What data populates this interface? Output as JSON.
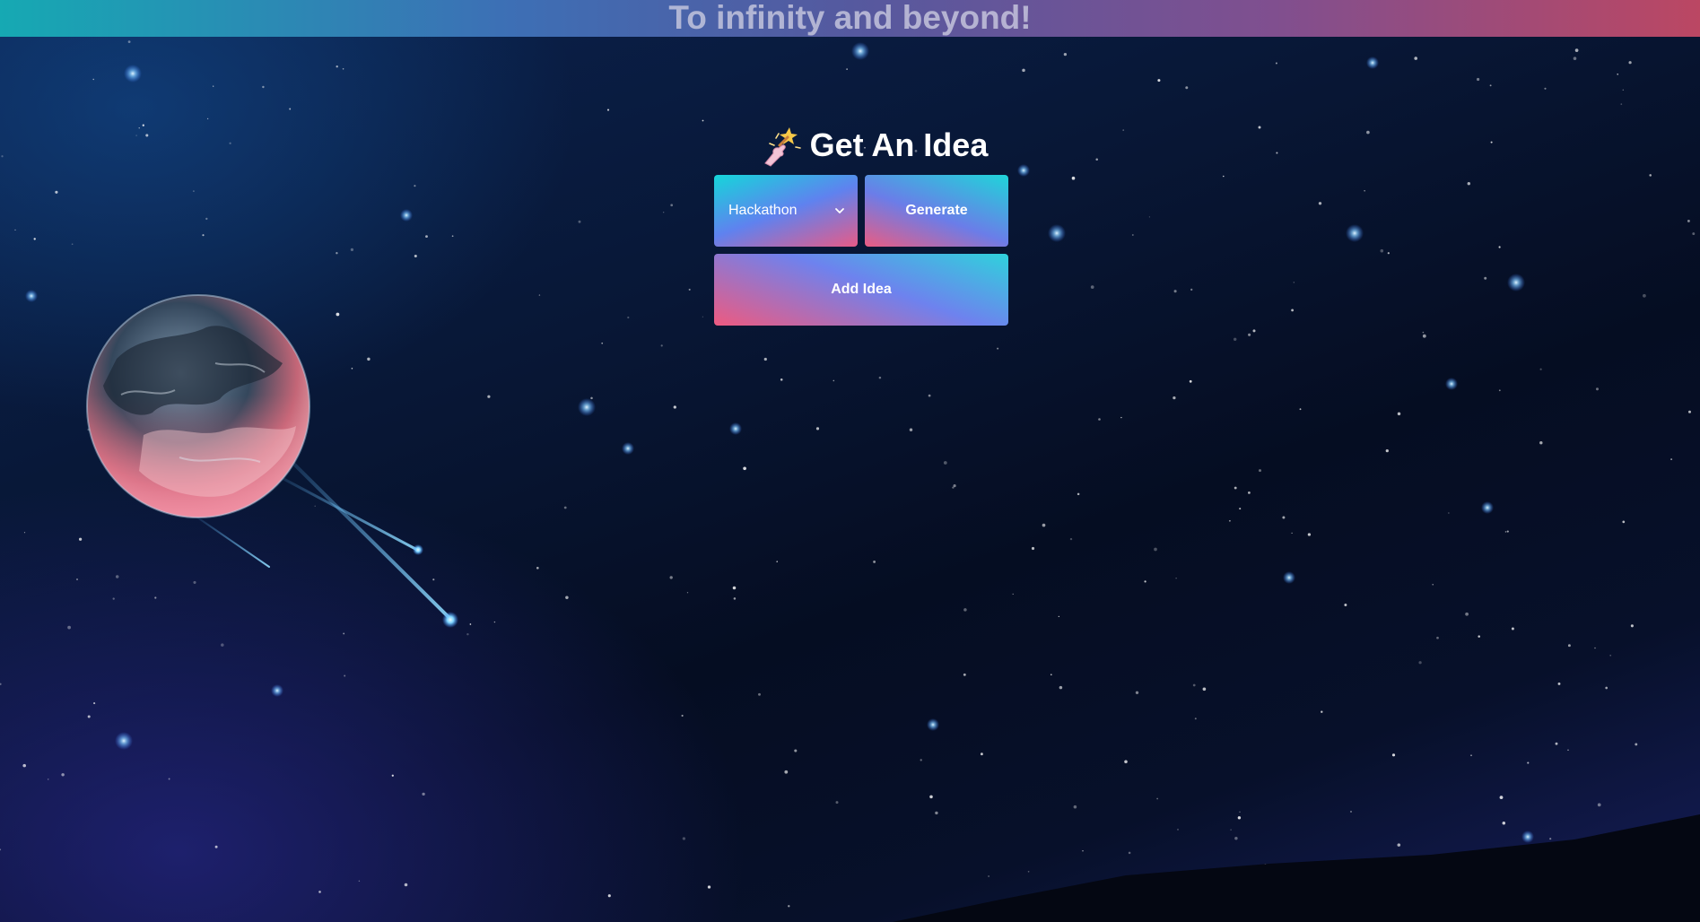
{
  "banner": {
    "title": "To infinity and beyond!"
  },
  "idea_panel": {
    "heading": "Get An Idea",
    "heading_icon": "magic-wand-hand-icon",
    "category_select": {
      "selected": "Hackathon",
      "icon": "chevron-down-icon"
    },
    "generate_label": "Generate",
    "add_idea_label": "Add Idea"
  },
  "background": {
    "scene": "starry-space-with-planet",
    "planet_icon": "planet-icon",
    "meteor_icon": "meteor-icon"
  },
  "colors": {
    "gradient_cyan": "#15d6da",
    "gradient_blue": "#5f82ef",
    "gradient_pink": "#e75b87",
    "banner_left": "#16a9b3",
    "banner_right": "#bb4763"
  }
}
